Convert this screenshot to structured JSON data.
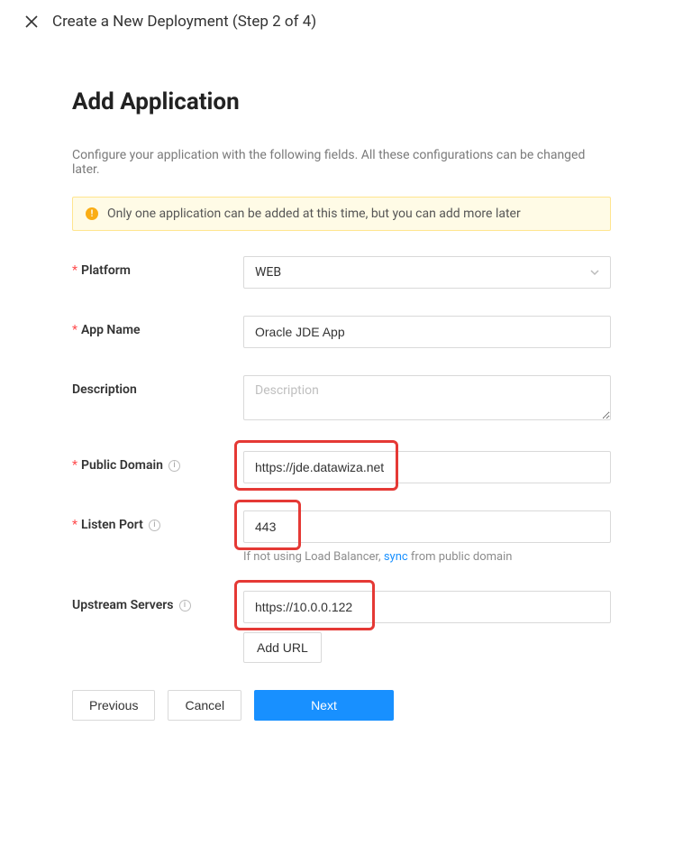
{
  "header": {
    "title": "Create a New Deployment (Step 2 of 4)"
  },
  "page": {
    "title": "Add Application",
    "intro": "Configure your application with the following fields. All these configurations can be changed later."
  },
  "alert": {
    "text": "Only one application can be added at this time, but you can add more later"
  },
  "form": {
    "platform": {
      "label": "Platform",
      "value": "WEB"
    },
    "app_name": {
      "label": "App Name",
      "value": "Oracle JDE App"
    },
    "description": {
      "label": "Description",
      "placeholder": "Description",
      "value": ""
    },
    "public_domain": {
      "label": "Public Domain",
      "value": "https://jde.datawiza.net"
    },
    "listen_port": {
      "label": "Listen Port",
      "value": "443",
      "hint_pre": "If not using Load Balancer, ",
      "hint_link": "sync",
      "hint_post": " from public domain"
    },
    "upstream": {
      "label": "Upstream Servers",
      "value": "https://10.0.0.122",
      "add_label": "Add URL"
    }
  },
  "footer": {
    "previous": "Previous",
    "cancel": "Cancel",
    "next": "Next"
  }
}
